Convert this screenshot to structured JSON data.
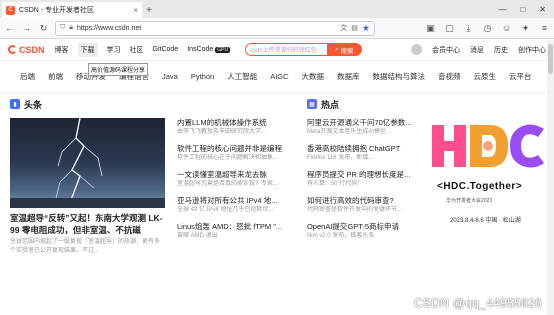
{
  "browser": {
    "tab_title": "CSDN - 专业开发者社区",
    "tab_close": "×",
    "new_tab": "+",
    "window_controls": [
      "—",
      "□",
      "✕"
    ],
    "url": "https://www.csdn.net"
  },
  "site": {
    "logo": "CSDN",
    "nav": [
      "博客",
      "下载",
      "学习",
      "社区",
      "GitCode",
      "InsCode"
    ],
    "inscode_badge": "GPU",
    "search_placeholder": "csdn上传资源扫码领红包",
    "search_button": "搜索",
    "right_links": [
      "会员中心",
      "消息",
      "历史",
      "创作中心"
    ],
    "tooltip": "高价值源码课程分享"
  },
  "categories": [
    "后端",
    "前端",
    "移动开发",
    "编程语言",
    "Java",
    "Python",
    "人工智能",
    "AIGC",
    "大数据",
    "数据库",
    "数据结构与算法",
    "音视频",
    "云原生",
    "云平台"
  ],
  "headline": {
    "section": "头条",
    "title": "室温超导“反转”又起！东南大学观测 LK-99 零电阻成功，但非室温、不抗磁",
    "desc": "全球范围内掀起了一股复现「室温超导」的热潮，更有多个实验室已公开复现结果，不过..."
  },
  "middle_items": [
    {
      "title": "内置LLM的机械体操作系统",
      "desc": "由李飞飞教授及丰田研究院大学..."
    },
    {
      "title": "软件工程的核心问题并非是编程",
      "desc": "软件工程的核心在于问题解决和抽象..."
    },
    {
      "title": "一文读懂室温超导来龙去脉",
      "desc": "室温超导究竟是否真的能实现？专家..."
    },
    {
      "title": "亚马逊将对所有公共 IPv4 地...",
      "desc": "全球 43 亿 IPv4 地址几乎已经耗尽..."
    },
    {
      "title": "Linus炮轰 AMD：怒批 fTPM \"...",
      "desc": "曾喊 AMD 退出"
    }
  ],
  "hot": {
    "section": "热点",
    "items": [
      {
        "title": "阿里云开源通义千问70亿参数...",
        "desc": "Meta开源文本音乐生成AI模型..."
      },
      {
        "title": "香港高校陆续拥抱 ChatGPT",
        "desc": "Firefox 116 发布，新增..."
      },
      {
        "title": "程序员提交 PR 的理想长度是...",
        "desc": "有人算：50 行代码！"
      },
      {
        "title": "如何进行高效的代码审查?",
        "desc": "代码审查是软件开发中的关键环节..."
      },
      {
        "title": "OpenAI提交GPT-5商标申请",
        "desc": "Nim v2.0 发布，极客头条"
      }
    ]
  },
  "ad": {
    "title": "<HDC.Together>",
    "subtitle": "华为开发者大会2023",
    "date": "2023.8.4-8.6 中国 · 松山湖"
  },
  "watermark": "CSDN @qq_44955826",
  "colors": {
    "brand": "#fc5531",
    "hot_icon": "#5a6cf0"
  }
}
